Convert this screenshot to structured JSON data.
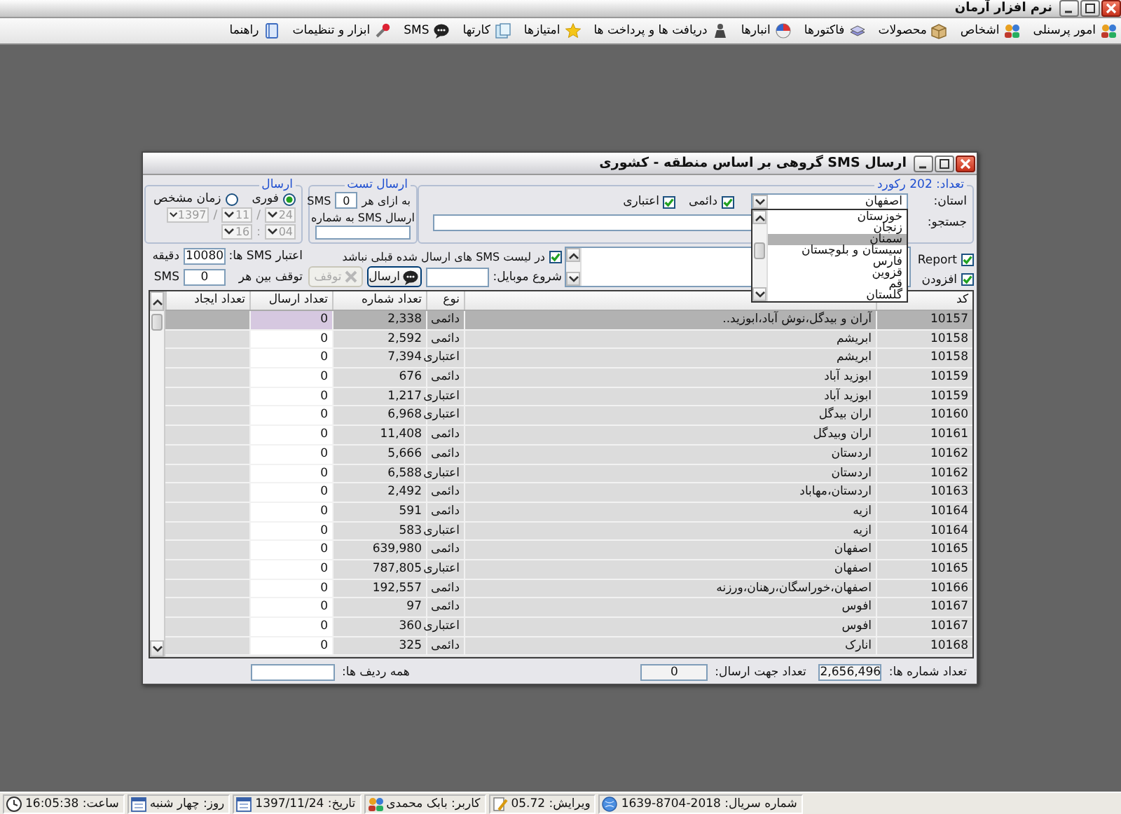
{
  "app": {
    "title": "نرم افزار آرمان"
  },
  "menu": [
    {
      "label": "امور پرسنلی"
    },
    {
      "label": "اشخاص"
    },
    {
      "label": "محصولات"
    },
    {
      "label": "فاکتورها"
    },
    {
      "label": "انبارها"
    },
    {
      "label": "دریافت ها و پرداخت ها"
    },
    {
      "label": "امتیازها"
    },
    {
      "label": "کارتها"
    },
    {
      "label": "SMS"
    },
    {
      "label": "ابزار و تنظیمات"
    },
    {
      "label": "راهنما"
    }
  ],
  "dialog": {
    "title": "ارسال SMS گروهی بر اساس منطقه - کشوری",
    "filter": {
      "legend": "تعداد: 202 رکورد",
      "province_label": "استان:",
      "province": "اصفهان",
      "options": [
        {
          "label": "خوزستان",
          "selected": false
        },
        {
          "label": "زنجان",
          "selected": false
        },
        {
          "label": "سمنان",
          "selected": true
        },
        {
          "label": "سیستان و بلوچستان",
          "selected": false
        },
        {
          "label": "فارس",
          "selected": false
        },
        {
          "label": "قزوین",
          "selected": false
        },
        {
          "label": "قم",
          "selected": false
        },
        {
          "label": "گلستان",
          "selected": false
        }
      ],
      "types": [
        {
          "label": "دائمی",
          "checked": true
        },
        {
          "label": "اعتباری",
          "checked": true
        }
      ],
      "search_label": "جستجو:"
    },
    "extras": [
      {
        "label": "Report",
        "checked": true
      },
      {
        "label": "افزودن",
        "checked": true
      }
    ],
    "exclude_sent": {
      "label": "در لیست SMS های ارسال شده قبلی نباشد",
      "checked": true
    },
    "mobile_start_label": "شروع موبایل:",
    "send_button": {
      "label": "ارسال",
      "disabled": false
    },
    "stop_button": {
      "label": "توقف",
      "disabled": true
    },
    "test": {
      "legend": "ارسال تست",
      "per_label": "به ازای هر",
      "per_value": "0",
      "per_unit": "SMS",
      "to_label": "ارسال SMS به شماره"
    },
    "schedule": {
      "legend": "ارسال",
      "modes": [
        {
          "label": "فوری",
          "selected": true
        },
        {
          "label": "زمان مشخص",
          "selected": false
        }
      ],
      "date": [
        "24",
        "11",
        "1397"
      ],
      "date_separator": "/",
      "time": [
        "04",
        "16"
      ],
      "time_separator": ":",
      "disabled": true
    },
    "limits": [
      {
        "label": "اعتبار SMS ها:",
        "value": "10080",
        "unit": "دقیقه"
      },
      {
        "label": "توقف بین هر",
        "value": "0",
        "unit": "SMS"
      }
    ],
    "table": {
      "columns": [
        "کد",
        "نوع",
        "تعداد شماره",
        "تعداد ارسال",
        "تعداد ایجاد"
      ],
      "rows": [
        {
          "code": "10157",
          "name": "آران و بیدگل،نوش آباد،ابوزید..",
          "type": "دائمی",
          "numbers": "2,338",
          "sent": "0",
          "selected": true
        },
        {
          "code": "10158",
          "name": "ابریشم",
          "type": "دائمی",
          "numbers": "2,592",
          "sent": "0",
          "selected": false
        },
        {
          "code": "10158",
          "name": "ابریشم",
          "type": "اعتباری",
          "numbers": "7,394",
          "sent": "0",
          "selected": false
        },
        {
          "code": "10159",
          "name": "ابوزید آباد",
          "type": "دائمی",
          "numbers": "676",
          "sent": "0",
          "selected": false
        },
        {
          "code": "10159",
          "name": "ابوزید آباد",
          "type": "اعتباری",
          "numbers": "1,217",
          "sent": "0",
          "selected": false
        },
        {
          "code": "10160",
          "name": "اران بیدگل",
          "type": "اعتباری",
          "numbers": "6,968",
          "sent": "0",
          "selected": false
        },
        {
          "code": "10161",
          "name": "اران وبیدگل",
          "type": "دائمی",
          "numbers": "11,408",
          "sent": "0",
          "selected": false
        },
        {
          "code": "10162",
          "name": "اردستان",
          "type": "دائمی",
          "numbers": "5,666",
          "sent": "0",
          "selected": false
        },
        {
          "code": "10162",
          "name": "اردستان",
          "type": "اعتباری",
          "numbers": "6,588",
          "sent": "0",
          "selected": false
        },
        {
          "code": "10163",
          "name": "اردستان،مهاباد",
          "type": "دائمی",
          "numbers": "2,492",
          "sent": "0",
          "selected": false
        },
        {
          "code": "10164",
          "name": "ازیه",
          "type": "دائمی",
          "numbers": "591",
          "sent": "0",
          "selected": false
        },
        {
          "code": "10164",
          "name": "ازیه",
          "type": "اعتباری",
          "numbers": "583",
          "sent": "0",
          "selected": false
        },
        {
          "code": "10165",
          "name": "اصفهان",
          "type": "دائمی",
          "numbers": "639,980",
          "sent": "0",
          "selected": false
        },
        {
          "code": "10165",
          "name": "اصفهان",
          "type": "اعتباری",
          "numbers": "787,805",
          "sent": "0",
          "selected": false
        },
        {
          "code": "10166",
          "name": "اصفهان،خوراسگان،رهنان،ورزنه",
          "type": "دائمی",
          "numbers": "192,557",
          "sent": "0",
          "selected": false
        },
        {
          "code": "10167",
          "name": "افوس",
          "type": "دائمی",
          "numbers": "97",
          "sent": "0",
          "selected": false
        },
        {
          "code": "10167",
          "name": "افوس",
          "type": "اعتباری",
          "numbers": "360",
          "sent": "0",
          "selected": false
        },
        {
          "code": "10168",
          "name": "انارک",
          "type": "دائمی",
          "numbers": "325",
          "sent": "0",
          "selected": false
        }
      ]
    },
    "footer": {
      "total_label": "تعداد شماره ها:",
      "total": "2,656,496",
      "to_send_label": "تعداد جهت ارسال:",
      "to_send": "0",
      "all_rows_label": "همه ردیف ها:"
    }
  },
  "status_bar": [
    {
      "label": "شماره سریال: 2018-8704-1639"
    },
    {
      "label": "ویرایش: 05.72"
    },
    {
      "label": "کاربر: بابک محمدی"
    },
    {
      "label": "تاریخ: 1397/11/24"
    },
    {
      "label": "روز: چهار شنبه"
    },
    {
      "label": "ساعت: 16:05:38"
    }
  ]
}
